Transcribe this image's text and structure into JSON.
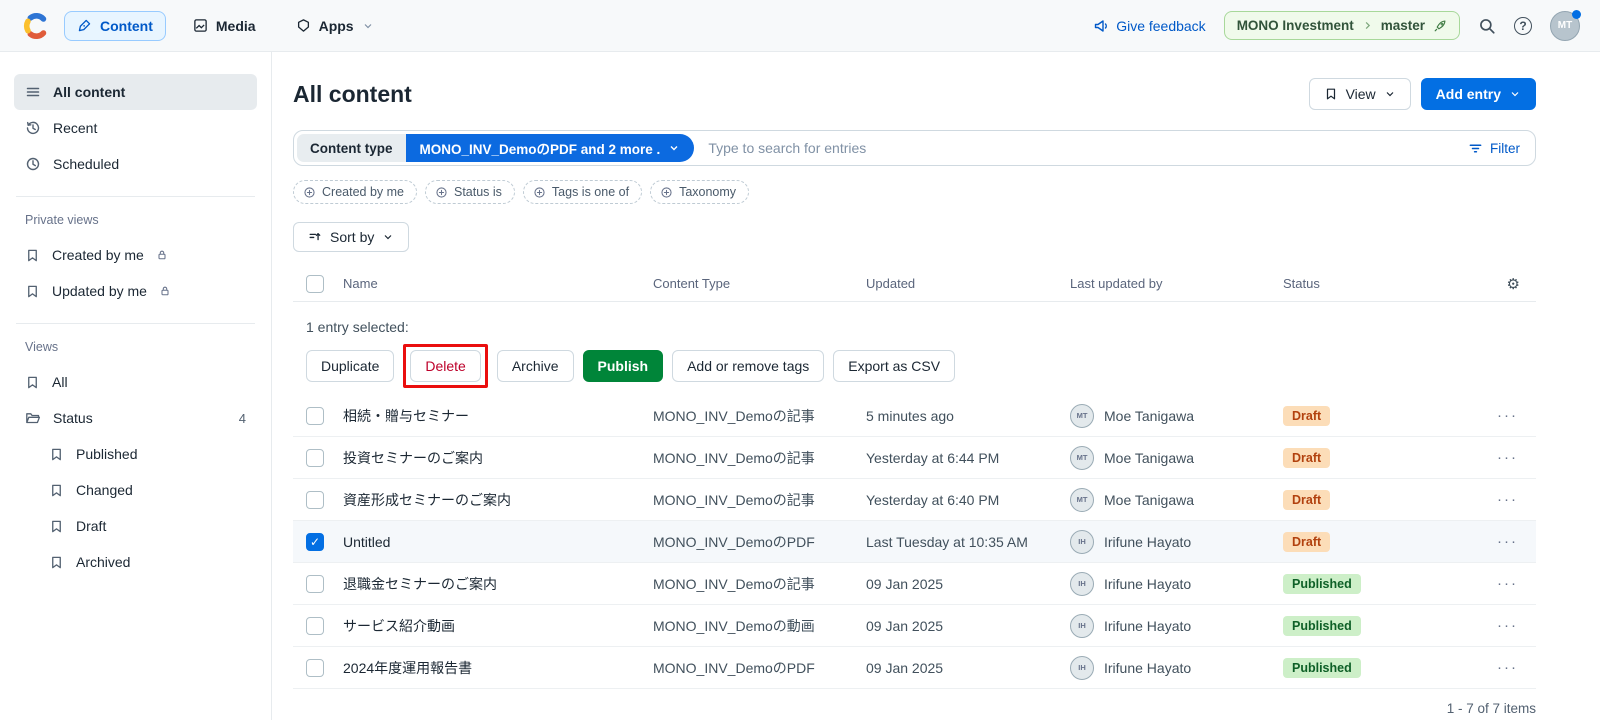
{
  "colors": {
    "accent_blue": "#036FE3",
    "link_blue": "#0059C8",
    "publish_green": "#008539",
    "env_badge_bg": "#F0FAEB",
    "env_badge_border": "#A8D89A",
    "draft_badge_bg": "#FCDDB8",
    "draft_badge_text": "#B2410E",
    "published_badge_bg": "#CDEFC8",
    "published_badge_text": "#0E6027",
    "delete_red": "#BD002A",
    "annotation_red": "#EA0E0E",
    "selected_row_bg": "#F5F8FB"
  },
  "topbar": {
    "content_tab": "Content",
    "media_tab": "Media",
    "apps_tab": "Apps",
    "give_feedback": "Give feedback",
    "space_name": "MONO Investment",
    "environment": "master",
    "avatar_initials": "MT"
  },
  "sidebar": {
    "all_content": "All content",
    "recent": "Recent",
    "scheduled": "Scheduled",
    "private_views_label": "Private views",
    "created_by_me": "Created by me",
    "updated_by_me": "Updated by me",
    "views_label": "Views",
    "all": "All",
    "status": "Status",
    "status_count": "4",
    "status_children": [
      "Published",
      "Changed",
      "Draft",
      "Archived"
    ]
  },
  "main": {
    "title": "All content",
    "view_button": "View",
    "add_entry_button": "Add entry",
    "search": {
      "content_type_label": "Content type",
      "content_type_value": "MONO_INV_DemoのPDF and 2 more .",
      "placeholder": "Type to search for entries",
      "filter_label": "Filter"
    },
    "filter_pills": [
      "Created by me",
      "Status is",
      "Tags is one of",
      "Taxonomy"
    ],
    "sort_by_label": "Sort by",
    "selection": {
      "text": "1 entry selected:",
      "actions": [
        "Duplicate",
        "Delete",
        "Archive",
        "Publish",
        "Add or remove tags",
        "Export as CSV"
      ]
    },
    "table": {
      "columns": [
        "Name",
        "Content Type",
        "Updated",
        "Last updated by",
        "Status"
      ],
      "rows": [
        {
          "name": "相続・贈与セミナー",
          "type": "MONO_INV_Demoの記事",
          "updated": "5 minutes ago",
          "by": "Moe Tanigawa",
          "initials": "MT",
          "status": "Draft",
          "checked": false
        },
        {
          "name": "投資セミナーのご案内",
          "type": "MONO_INV_Demoの記事",
          "updated": "Yesterday at 6:44 PM",
          "by": "Moe Tanigawa",
          "initials": "MT",
          "status": "Draft",
          "checked": false
        },
        {
          "name": "資産形成セミナーのご案内",
          "type": "MONO_INV_Demoの記事",
          "updated": "Yesterday at 6:40 PM",
          "by": "Moe Tanigawa",
          "initials": "MT",
          "status": "Draft",
          "checked": false
        },
        {
          "name": "Untitled",
          "type": "MONO_INV_DemoのPDF",
          "updated": "Last Tuesday at 10:35 AM",
          "by": "Irifune Hayato",
          "initials": "IH",
          "status": "Draft",
          "checked": true
        },
        {
          "name": "退職金セミナーのご案内",
          "type": "MONO_INV_Demoの記事",
          "updated": "09 Jan 2025",
          "by": "Irifune Hayato",
          "initials": "IH",
          "status": "Published",
          "checked": false
        },
        {
          "name": "サービス紹介動画",
          "type": "MONO_INV_Demoの動画",
          "updated": "09 Jan 2025",
          "by": "Irifune Hayato",
          "initials": "IH",
          "status": "Published",
          "checked": false
        },
        {
          "name": "2024年度運用報告書",
          "type": "MONO_INV_DemoのPDF",
          "updated": "09 Jan 2025",
          "by": "Irifune Hayato",
          "initials": "IH",
          "status": "Published",
          "checked": false
        }
      ]
    },
    "pagination": "1 - 7 of 7 items"
  }
}
